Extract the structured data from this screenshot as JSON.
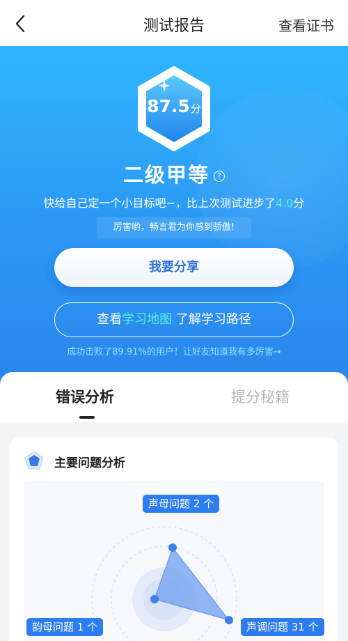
{
  "nav": {
    "title": "测试报告",
    "certificate": "查看证书"
  },
  "hero": {
    "score": "87.5",
    "score_unit": "分",
    "level": "二级甲等",
    "level_help": "?",
    "progress_prefix": "快给自己定一个小目标吧~，比上次测试进步了",
    "progress_value": "4.0",
    "progress_suffix": "分",
    "praise": "厉害哟，畅言君为你感到骄傲!",
    "share_button": "我要分享",
    "map_prefix": "查看",
    "map_link": "学习地图",
    "map_suffix": " 了解学习路径",
    "beat_text": "成功击败了89.91%的用户！让好友知道我有多厉害→"
  },
  "tabs": [
    {
      "label": "错误分析",
      "active": true
    },
    {
      "label": "提分秘籍",
      "active": false
    }
  ],
  "card": {
    "title": "主要问题分析",
    "tags": {
      "initials": "声母问题 2 个",
      "finals": "韵母问题 1 个",
      "tones": "声调问题 31 个"
    },
    "radar_values": {
      "initials": 2,
      "finals": 1,
      "tones": 31
    }
  },
  "colors": {
    "accent": "#2d7cf0",
    "highlight": "#59f3e3",
    "hero_top": "#2fb6ff",
    "hero_bottom": "#2a84ec"
  }
}
